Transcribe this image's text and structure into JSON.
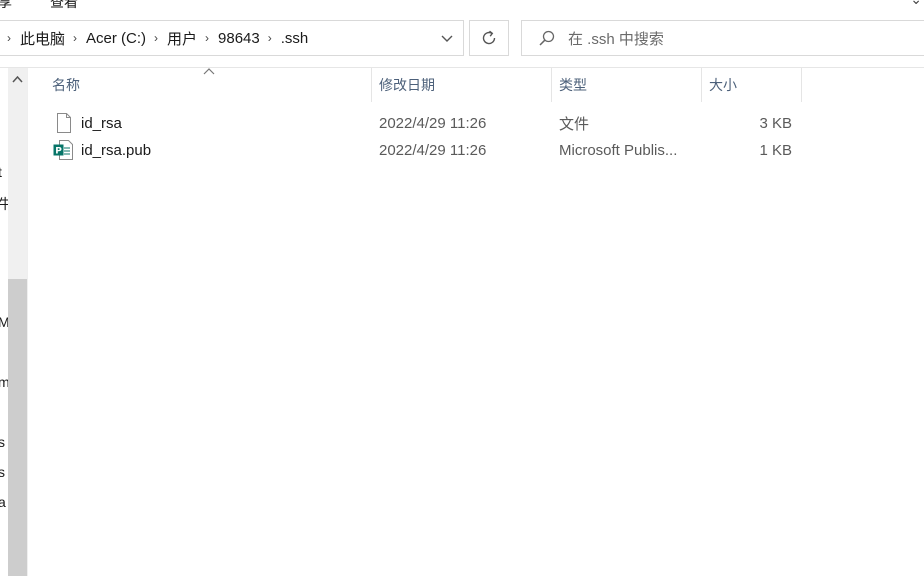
{
  "ribbon": {
    "tab_share": "享",
    "tab_view": "查看"
  },
  "address_bar": {
    "breadcrumbs": [
      "此电脑",
      "Acer (C:)",
      "用户",
      "98643",
      ".ssh"
    ]
  },
  "search": {
    "placeholder": "在 .ssh 中搜索"
  },
  "nav_fragments": [
    "t",
    "牛",
    "M",
    "m",
    "s",
    "s",
    "a"
  ],
  "columns": {
    "name": "名称",
    "date": "修改日期",
    "type": "类型",
    "size": "大小"
  },
  "files": [
    {
      "name": "id_rsa",
      "date": "2022/4/29 11:26",
      "type": "文件",
      "size": "3 KB",
      "icon": "blank-file-icon"
    },
    {
      "name": "id_rsa.pub",
      "date": "2022/4/29 11:26",
      "type": "Microsoft Publis...",
      "size": "1 KB",
      "icon": "publisher-file-icon"
    }
  ],
  "colors": {
    "header_text": "#4c607a",
    "border": "#d9d9d9",
    "scroll_thumb": "#cdcdcd",
    "publisher_teal": "#077568"
  }
}
